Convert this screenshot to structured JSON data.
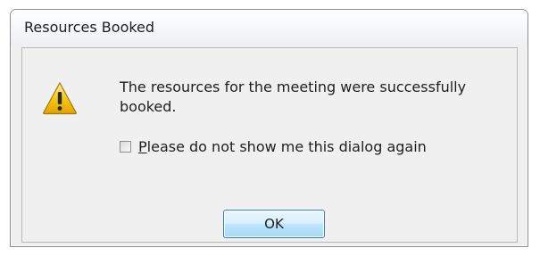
{
  "dialog": {
    "title": "Resources Booked",
    "icon": "warning-icon",
    "message": "The resources for the meeting were successfully booked.",
    "checkbox": {
      "mnemonic": "P",
      "label_rest": "lease do not show me this dialog again",
      "checked": false
    },
    "ok_label": "OK"
  },
  "colors": {
    "warning_fill": "#f5c816",
    "button_border": "#3c7fb1"
  }
}
